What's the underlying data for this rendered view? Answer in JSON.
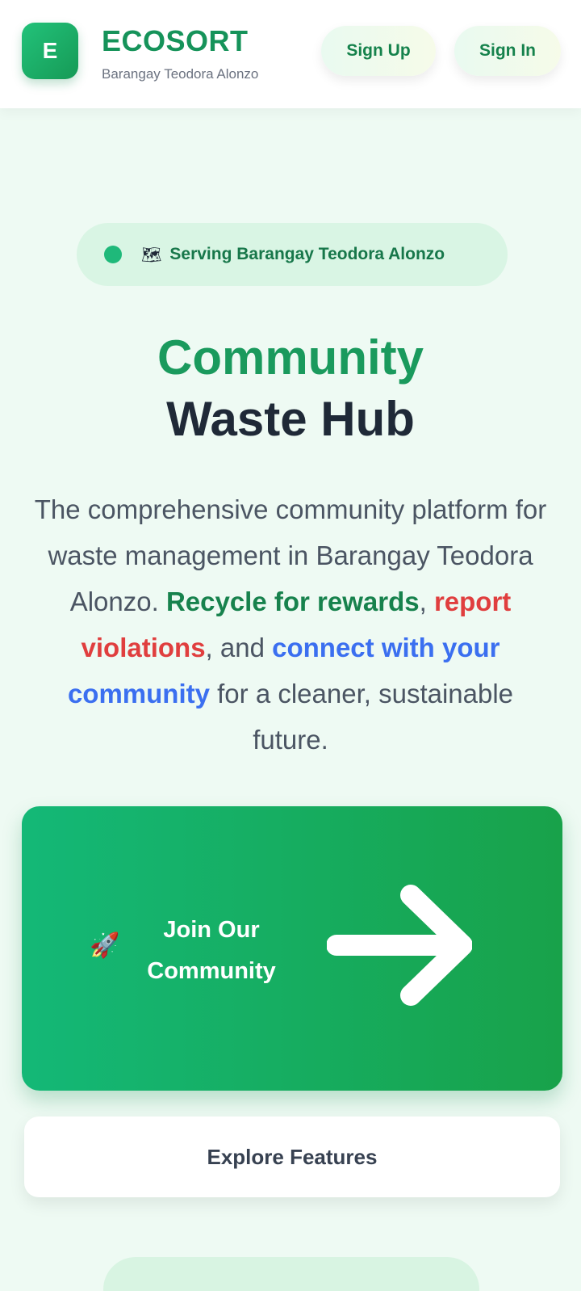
{
  "header": {
    "logo_letter": "E",
    "brand_name": "ECOSORT",
    "brand_subtitle": "Barangay Teodora Alonzo",
    "signup_label": "Sign Up",
    "signin_label": "Sign In"
  },
  "badge": {
    "icon": "🗺",
    "text": "Serving Barangay Teodora Alonzo"
  },
  "hero": {
    "title_line1": "Community",
    "title_line2": "Waste Hub",
    "desc_lead": "The comprehensive community platform for waste management in Barangay Teodora Alonzo. ",
    "desc_green": "Recycle for rewards",
    "desc_sep1": ", ",
    "desc_red": "report violations",
    "desc_sep2": ", and ",
    "desc_blue": "connect with your community",
    "desc_tail": " for a cleaner, sustainable future."
  },
  "cta": {
    "rocket_icon": "🚀",
    "join_label": "Join Our Community",
    "explore_label": "Explore Features"
  },
  "colors": {
    "brand_green": "#16935a",
    "accent_red": "#e03e3e",
    "accent_blue": "#3b6ff0"
  }
}
